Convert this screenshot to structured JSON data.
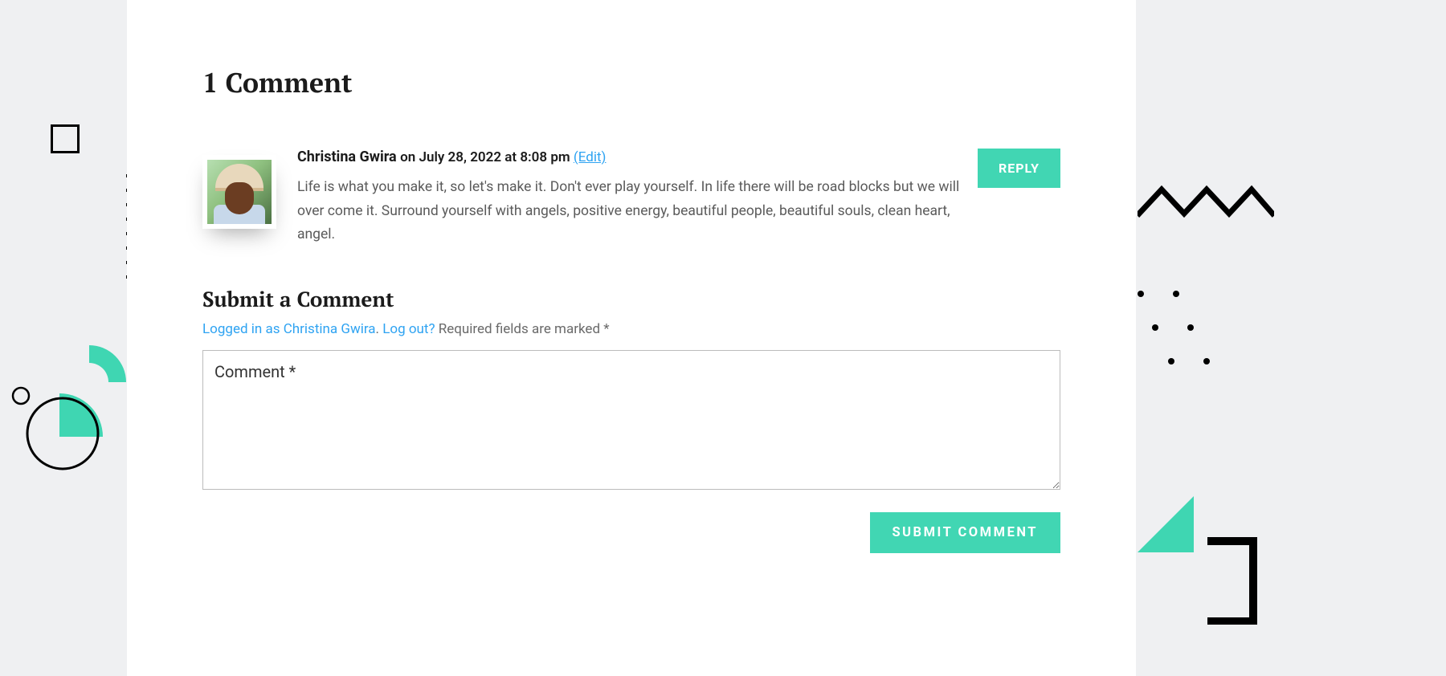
{
  "comments_heading": "1 Comment",
  "comment": {
    "author": "Christina Gwira",
    "meta": "on July 28, 2022 at 8:08 pm",
    "edit": "(Edit)",
    "body": "Life is what you make it, so let's make it. Don't ever play yourself. In life there will be road blocks but we will over come it. Surround yourself with angels, positive energy, beautiful people, beautiful souls, clean heart, angel.",
    "reply": "REPLY"
  },
  "form": {
    "heading": "Submit a Comment",
    "logged_in": "Logged in as Christina Gwira",
    "dot": ". ",
    "logout": "Log out?",
    "required": " Required fields are marked *",
    "placeholder": "Comment *",
    "submit": "SUBMIT COMMENT"
  }
}
